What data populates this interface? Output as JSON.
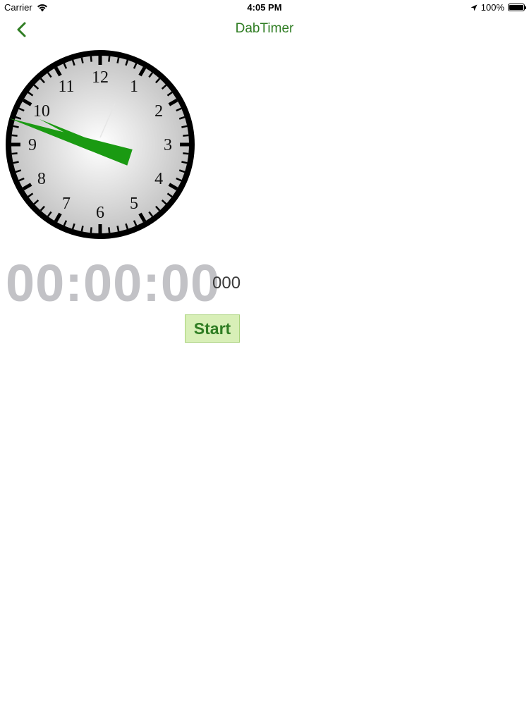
{
  "status_bar": {
    "carrier": "Carrier",
    "time": "4:05 PM",
    "battery": "100%",
    "battery_level": 1.0
  },
  "nav": {
    "title": "DabTimer",
    "back_icon": "chevron-left-icon"
  },
  "clock": {
    "numerals": [
      "12",
      "1",
      "2",
      "3",
      "4",
      "5",
      "6",
      "7",
      "8",
      "9",
      "10",
      "11"
    ],
    "hour": 9,
    "minute": 8.5,
    "second": 2.2,
    "colors": {
      "hand": "#1a9a12",
      "rim": "#000000",
      "face_center": "#ffffff",
      "face_edge": "#c4c4c4"
    }
  },
  "timer": {
    "display": "00:00:00",
    "milliseconds": "000"
  },
  "controls": {
    "start_label": "Start"
  },
  "colors": {
    "accent": "#2f7d23",
    "button_bg": "#d8efb7",
    "timer_text": "#c2c2c6"
  }
}
